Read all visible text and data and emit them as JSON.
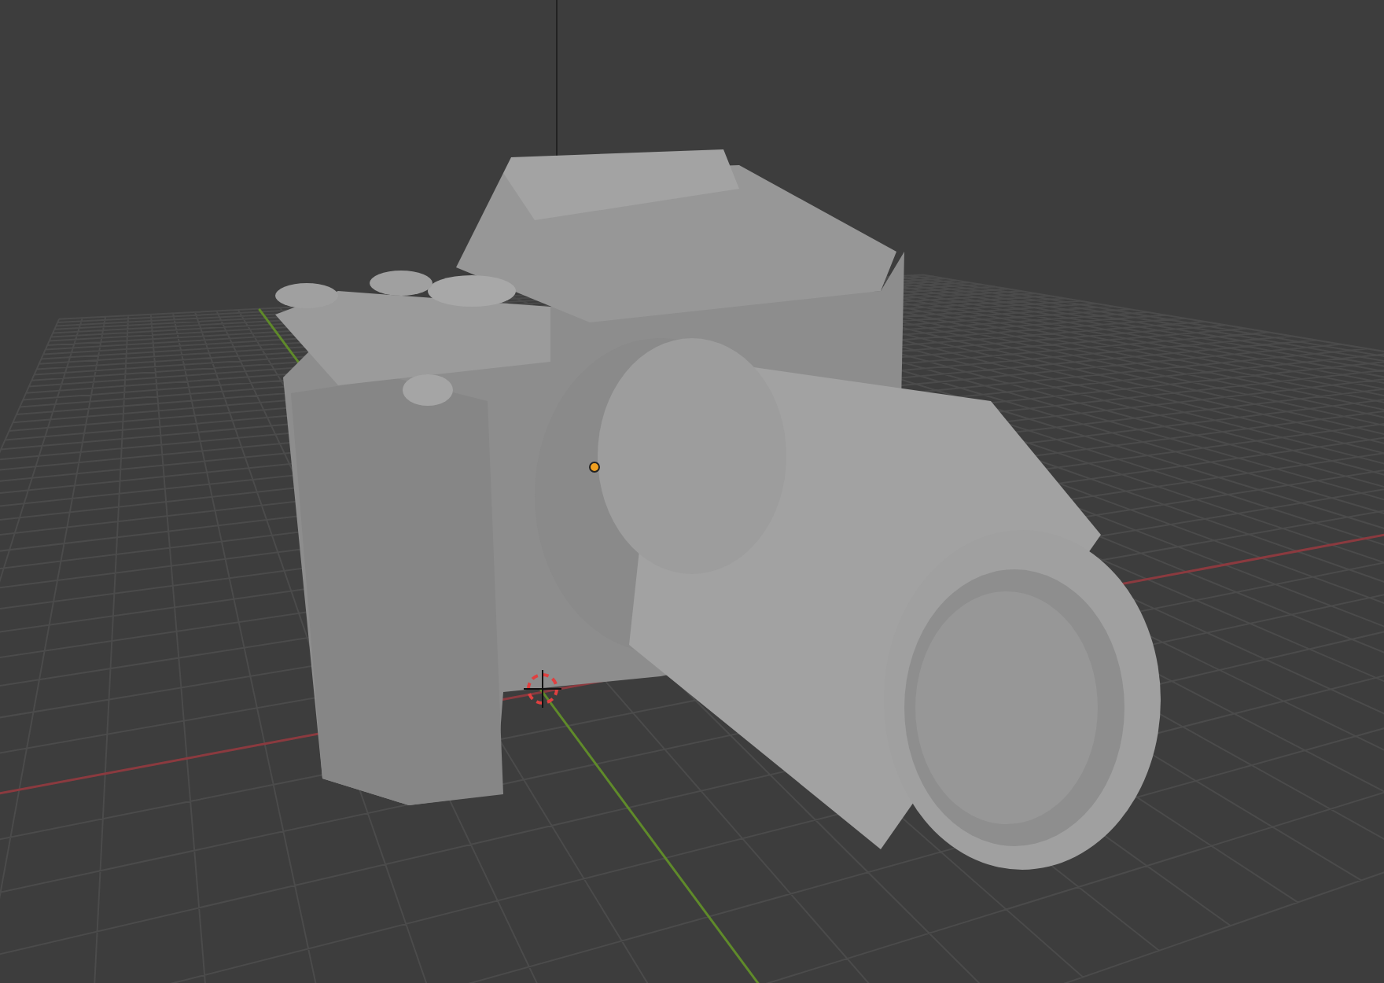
{
  "viewport": {
    "grid": true,
    "x_axis": true,
    "y_axis": true,
    "cursor_3d": true,
    "origin_dot": true
  }
}
